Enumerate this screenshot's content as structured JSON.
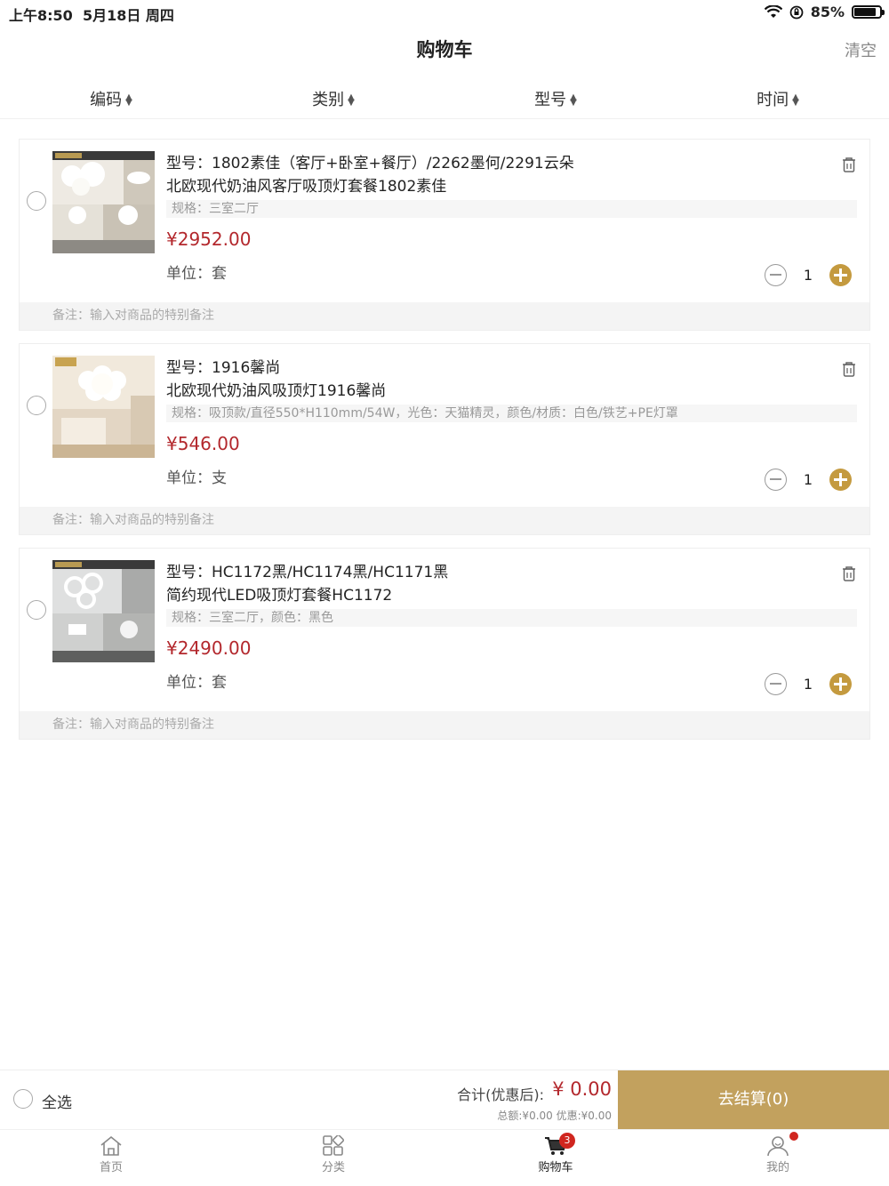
{
  "status_bar": {
    "time": "上午8:50",
    "date": "5月18日 周四",
    "battery": "85%",
    "battery_level": 0.85
  },
  "nav": {
    "title": "购物车",
    "clear_label": "清空"
  },
  "sort_bar": [
    {
      "label": "编码"
    },
    {
      "label": "类别"
    },
    {
      "label": "型号"
    },
    {
      "label": "时间"
    }
  ],
  "cart_items": [
    {
      "model": "型号：1802素佳（客厅+卧室+餐厅）/2262墨何/2291云朵",
      "name": "北欧现代奶油风客厅吸顶灯套餐1802素佳",
      "spec": "规格：三室二厅",
      "price": "¥2952.00",
      "unit": "单位：套",
      "quantity": "1",
      "remark_placeholder": "备注：输入对商品的特别备注"
    },
    {
      "model": "型号：1916馨尚",
      "name": "北欧现代奶油风吸顶灯1916馨尚",
      "spec": "规格：吸顶款/直径550*H110mm/54W，光色：天猫精灵，颜色/材质：白色/铁艺+PE灯罩",
      "price": "¥546.00",
      "unit": "单位：支",
      "quantity": "1",
      "remark_placeholder": "备注：输入对商品的特别备注"
    },
    {
      "model": "型号：HC1172黑/HC1174黑/HC1171黑",
      "name": "简约现代LED吸顶灯套餐HC1172",
      "spec": "规格：三室二厅，颜色：黑色",
      "price": "¥2490.00",
      "unit": "单位：套",
      "quantity": "1",
      "remark_placeholder": "备注：输入对商品的特别备注"
    }
  ],
  "checkout": {
    "select_all": "全选",
    "total_label": "合计(优惠后):",
    "total_value": "¥ 0.00",
    "sub_total": "总额:¥0.00 优惠:¥0.00",
    "checkout_button": "去结算(0)"
  },
  "tab_bar": [
    {
      "label": "首页",
      "icon": "home-icon"
    },
    {
      "label": "分类",
      "icon": "category-icon"
    },
    {
      "label": "购物车",
      "icon": "cart-icon",
      "badge": "3",
      "active": true
    },
    {
      "label": "我的",
      "icon": "profile-icon"
    }
  ],
  "colors": {
    "accent": "#c2a15e",
    "price": "#b3282d",
    "badge": "#d0261f",
    "plus": "#c49a3f"
  }
}
